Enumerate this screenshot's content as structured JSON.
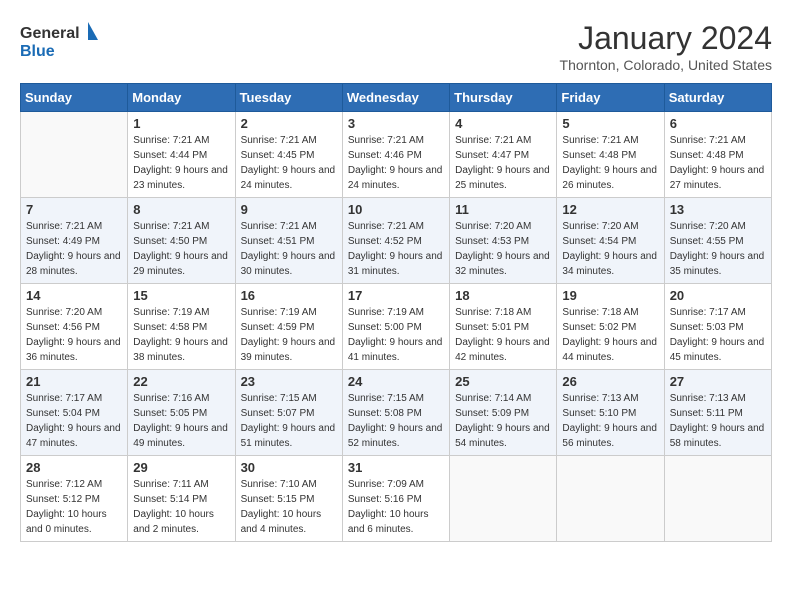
{
  "logo": {
    "general": "General",
    "blue": "Blue"
  },
  "header": {
    "month": "January 2024",
    "location": "Thornton, Colorado, United States"
  },
  "days_of_week": [
    "Sunday",
    "Monday",
    "Tuesday",
    "Wednesday",
    "Thursday",
    "Friday",
    "Saturday"
  ],
  "weeks": [
    {
      "days": [
        {
          "number": "",
          "sunrise": "",
          "sunset": "",
          "daylight": ""
        },
        {
          "number": "1",
          "sunrise": "Sunrise: 7:21 AM",
          "sunset": "Sunset: 4:44 PM",
          "daylight": "Daylight: 9 hours and 23 minutes."
        },
        {
          "number": "2",
          "sunrise": "Sunrise: 7:21 AM",
          "sunset": "Sunset: 4:45 PM",
          "daylight": "Daylight: 9 hours and 24 minutes."
        },
        {
          "number": "3",
          "sunrise": "Sunrise: 7:21 AM",
          "sunset": "Sunset: 4:46 PM",
          "daylight": "Daylight: 9 hours and 24 minutes."
        },
        {
          "number": "4",
          "sunrise": "Sunrise: 7:21 AM",
          "sunset": "Sunset: 4:47 PM",
          "daylight": "Daylight: 9 hours and 25 minutes."
        },
        {
          "number": "5",
          "sunrise": "Sunrise: 7:21 AM",
          "sunset": "Sunset: 4:48 PM",
          "daylight": "Daylight: 9 hours and 26 minutes."
        },
        {
          "number": "6",
          "sunrise": "Sunrise: 7:21 AM",
          "sunset": "Sunset: 4:48 PM",
          "daylight": "Daylight: 9 hours and 27 minutes."
        }
      ]
    },
    {
      "days": [
        {
          "number": "7",
          "sunrise": "Sunrise: 7:21 AM",
          "sunset": "Sunset: 4:49 PM",
          "daylight": "Daylight: 9 hours and 28 minutes."
        },
        {
          "number": "8",
          "sunrise": "Sunrise: 7:21 AM",
          "sunset": "Sunset: 4:50 PM",
          "daylight": "Daylight: 9 hours and 29 minutes."
        },
        {
          "number": "9",
          "sunrise": "Sunrise: 7:21 AM",
          "sunset": "Sunset: 4:51 PM",
          "daylight": "Daylight: 9 hours and 30 minutes."
        },
        {
          "number": "10",
          "sunrise": "Sunrise: 7:21 AM",
          "sunset": "Sunset: 4:52 PM",
          "daylight": "Daylight: 9 hours and 31 minutes."
        },
        {
          "number": "11",
          "sunrise": "Sunrise: 7:20 AM",
          "sunset": "Sunset: 4:53 PM",
          "daylight": "Daylight: 9 hours and 32 minutes."
        },
        {
          "number": "12",
          "sunrise": "Sunrise: 7:20 AM",
          "sunset": "Sunset: 4:54 PM",
          "daylight": "Daylight: 9 hours and 34 minutes."
        },
        {
          "number": "13",
          "sunrise": "Sunrise: 7:20 AM",
          "sunset": "Sunset: 4:55 PM",
          "daylight": "Daylight: 9 hours and 35 minutes."
        }
      ]
    },
    {
      "days": [
        {
          "number": "14",
          "sunrise": "Sunrise: 7:20 AM",
          "sunset": "Sunset: 4:56 PM",
          "daylight": "Daylight: 9 hours and 36 minutes."
        },
        {
          "number": "15",
          "sunrise": "Sunrise: 7:19 AM",
          "sunset": "Sunset: 4:58 PM",
          "daylight": "Daylight: 9 hours and 38 minutes."
        },
        {
          "number": "16",
          "sunrise": "Sunrise: 7:19 AM",
          "sunset": "Sunset: 4:59 PM",
          "daylight": "Daylight: 9 hours and 39 minutes."
        },
        {
          "number": "17",
          "sunrise": "Sunrise: 7:19 AM",
          "sunset": "Sunset: 5:00 PM",
          "daylight": "Daylight: 9 hours and 41 minutes."
        },
        {
          "number": "18",
          "sunrise": "Sunrise: 7:18 AM",
          "sunset": "Sunset: 5:01 PM",
          "daylight": "Daylight: 9 hours and 42 minutes."
        },
        {
          "number": "19",
          "sunrise": "Sunrise: 7:18 AM",
          "sunset": "Sunset: 5:02 PM",
          "daylight": "Daylight: 9 hours and 44 minutes."
        },
        {
          "number": "20",
          "sunrise": "Sunrise: 7:17 AM",
          "sunset": "Sunset: 5:03 PM",
          "daylight": "Daylight: 9 hours and 45 minutes."
        }
      ]
    },
    {
      "days": [
        {
          "number": "21",
          "sunrise": "Sunrise: 7:17 AM",
          "sunset": "Sunset: 5:04 PM",
          "daylight": "Daylight: 9 hours and 47 minutes."
        },
        {
          "number": "22",
          "sunrise": "Sunrise: 7:16 AM",
          "sunset": "Sunset: 5:05 PM",
          "daylight": "Daylight: 9 hours and 49 minutes."
        },
        {
          "number": "23",
          "sunrise": "Sunrise: 7:15 AM",
          "sunset": "Sunset: 5:07 PM",
          "daylight": "Daylight: 9 hours and 51 minutes."
        },
        {
          "number": "24",
          "sunrise": "Sunrise: 7:15 AM",
          "sunset": "Sunset: 5:08 PM",
          "daylight": "Daylight: 9 hours and 52 minutes."
        },
        {
          "number": "25",
          "sunrise": "Sunrise: 7:14 AM",
          "sunset": "Sunset: 5:09 PM",
          "daylight": "Daylight: 9 hours and 54 minutes."
        },
        {
          "number": "26",
          "sunrise": "Sunrise: 7:13 AM",
          "sunset": "Sunset: 5:10 PM",
          "daylight": "Daylight: 9 hours and 56 minutes."
        },
        {
          "number": "27",
          "sunrise": "Sunrise: 7:13 AM",
          "sunset": "Sunset: 5:11 PM",
          "daylight": "Daylight: 9 hours and 58 minutes."
        }
      ]
    },
    {
      "days": [
        {
          "number": "28",
          "sunrise": "Sunrise: 7:12 AM",
          "sunset": "Sunset: 5:12 PM",
          "daylight": "Daylight: 10 hours and 0 minutes."
        },
        {
          "number": "29",
          "sunrise": "Sunrise: 7:11 AM",
          "sunset": "Sunset: 5:14 PM",
          "daylight": "Daylight: 10 hours and 2 minutes."
        },
        {
          "number": "30",
          "sunrise": "Sunrise: 7:10 AM",
          "sunset": "Sunset: 5:15 PM",
          "daylight": "Daylight: 10 hours and 4 minutes."
        },
        {
          "number": "31",
          "sunrise": "Sunrise: 7:09 AM",
          "sunset": "Sunset: 5:16 PM",
          "daylight": "Daylight: 10 hours and 6 minutes."
        },
        {
          "number": "",
          "sunrise": "",
          "sunset": "",
          "daylight": ""
        },
        {
          "number": "",
          "sunrise": "",
          "sunset": "",
          "daylight": ""
        },
        {
          "number": "",
          "sunrise": "",
          "sunset": "",
          "daylight": ""
        }
      ]
    }
  ]
}
